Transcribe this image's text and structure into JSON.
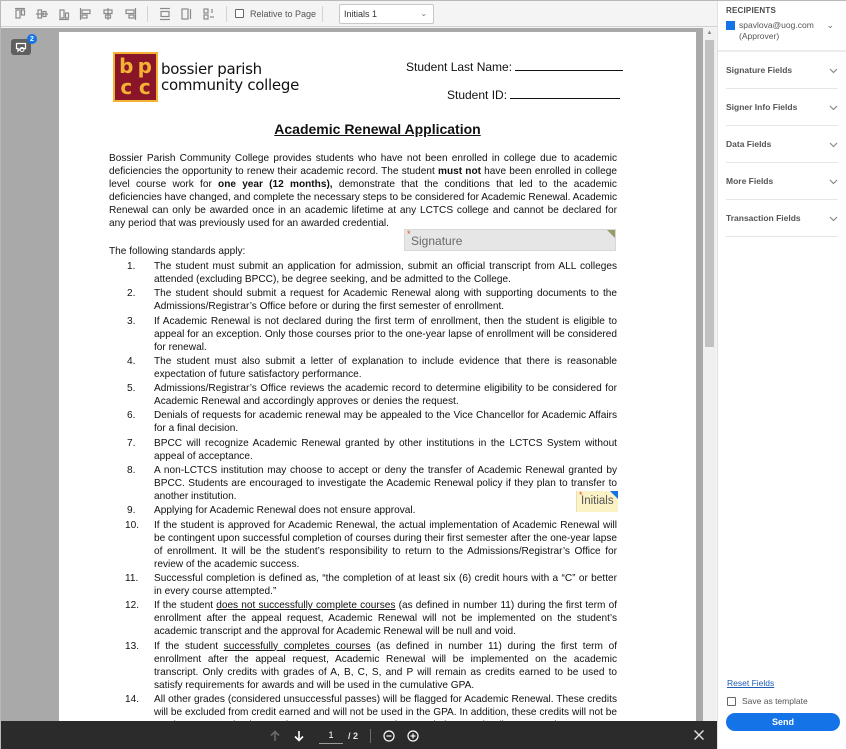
{
  "toolbar": {
    "align_icons": [
      "align-top-icon",
      "align-middle-icon",
      "align-bottom-icon",
      "align-left-icon",
      "align-center-icon",
      "align-right-icon"
    ],
    "distribute_icons": [
      "distribute-vertical-icon",
      "match-width-icon",
      "match-height-icon"
    ],
    "relative_to_page_label": "Relative to Page",
    "relative_to_page_checked": false,
    "field_select_value": "Initials 1"
  },
  "viewer": {
    "comment_badge_count": "2"
  },
  "document": {
    "logo": {
      "mark_letters": [
        "b",
        "p",
        "c",
        "c"
      ],
      "line1": "bossier parish",
      "line2": "community college",
      "colors": {
        "mark_bg": "#8a1529",
        "mark_fg": "#f2b233"
      }
    },
    "last_name_label": "Student Last Name:",
    "student_id_label": "Student ID:",
    "title": "Academic Renewal Application",
    "intro": {
      "p1": "Bossier Parish Community College provides students who have not been enrolled in college due to academic deficiencies the opportunity to renew their academic record. The student ",
      "b1": "must not",
      "p2": " have been enrolled in college level course work for ",
      "b2": "one year (12 months),",
      "p3": " demonstrate that the conditions that led to the academic deficiencies have changed, and complete the necessary steps to be considered for Academic Renewal. Academic Renewal can only be awarded once in an academic lifetime at any LCTCS college and cannot be declared for any period that was previously used for an awarded credential."
    },
    "standards_label": "The following standards apply:",
    "standards": [
      {
        "num": "1.",
        "text": "The student must submit an application for admission, submit an official transcript from ALL colleges attended (excluding BPCC), be degree seeking, and be admitted to the College."
      },
      {
        "num": "2.",
        "text": "The student should submit a request for Academic Renewal along with supporting documents to the Admissions/Registrar’s Office before or during the first semester of enrollment."
      },
      {
        "num": "3.",
        "text": "If Academic Renewal is not declared during the first term of enrollment, then the student is eligible to appeal for an exception.  Only those courses prior to the one-year lapse of enrollment will be considered for renewal."
      },
      {
        "num": "4.",
        "text": "The student must also submit a letter of explanation to include evidence that there is reasonable expectation of future satisfactory performance."
      },
      {
        "num": "5.",
        "text": "Admissions/Registrar’s Office reviews the academic record to determine eligibility to be considered for Academic Renewal and accordingly approves or denies the request."
      },
      {
        "num": "6.",
        "text": "Denials of requests for academic renewal may be appealed to the Vice Chancellor for Academic Affairs for a final decision."
      },
      {
        "num": "7.",
        "text": "BPCC will recognize Academic Renewal granted by other institutions in the LCTCS System without appeal of acceptance."
      },
      {
        "num": "8.",
        "text": "A non-LCTCS institution may choose to accept or deny the transfer of Academic Renewal granted by BPCC. Students are encouraged to investigate the Academic Renewal policy if they plan to transfer to another institution."
      },
      {
        "num": "9.",
        "text": "Applying for Academic Renewal does not ensure approval."
      },
      {
        "num": "10.",
        "text": "If the student is approved for Academic Renewal, the actual implementation of Academic Renewal will be contingent upon successful completion of courses during their first semester after the one-year lapse of enrollment.  It will be the student’s responsibility to return to the Admissions/Registrar’s Office for review of the academic success."
      },
      {
        "num": "11.",
        "text": "Successful completion is defined as, “the completion of at least six (6) credit hours with a “C” or better in every course attempted.”"
      },
      {
        "num": "12.",
        "pre": "If the student ",
        "underlined": "does not successfully complete courses",
        "text": " (as defined in number 11) during the first term of enrollment after the appeal request, Academic Renewal will not be implemented on the student’s academic transcript and the approval for Academic Renewal will be null and void."
      },
      {
        "num": "13.",
        "pre": "If the student ",
        "underlined": "successfully completes courses",
        "text": " (as defined in number 11) during the first term of enrollment after the appeal request, Academic Renewal will be implemented on the academic transcript. Only credits with grades of A, B, C, S, and P will remain as credits earned to be used to satisfy requirements for awards and will be used in the cumulative GPA."
      },
      {
        "num": "14.",
        "text": "All other grades (considered unsuccessful passes) will be flagged for Academic Renewal. These credits will be excluded from credit earned and will not be used in the GPA. In addition, these credits will not be used to meet graduation requirements or to compute the cumulative GPA leading to awards."
      }
    ],
    "signature_field": {
      "label": "Signature",
      "required": true,
      "corner_color": "#9a9a6a"
    },
    "initials_field": {
      "label": "Initials",
      "required": true,
      "corner_color": "#1473e6"
    }
  },
  "bottom_bar": {
    "current_page": "1",
    "total_pages": "/ 2"
  },
  "panel": {
    "recipients_title": "RECIPIENTS",
    "recipient_email": "spavlova@uog.com",
    "recipient_role": "(Approver)",
    "recipient_color": "#1473e6",
    "sections": [
      "Signature Fields",
      "Signer Info Fields",
      "Data Fields",
      "More Fields",
      "Transaction Fields"
    ],
    "reset_label": "Reset Fields",
    "save_template_label": "Save as template",
    "save_template_checked": false,
    "send_label": "Send",
    "accent": "#1473e6"
  }
}
